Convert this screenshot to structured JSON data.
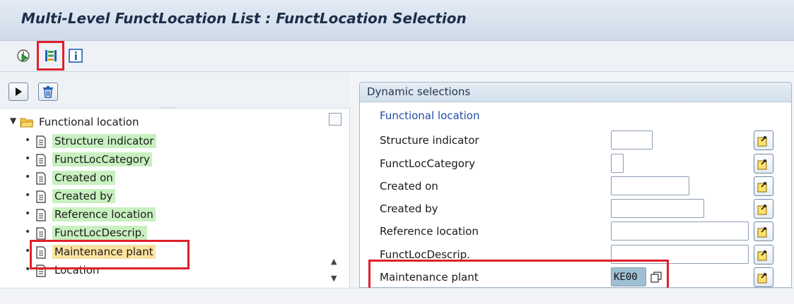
{
  "title": "Multi-Level FunctLocation List : FunctLocation Selection",
  "toolbar": {
    "execute_icon": "execute-clock-icon",
    "dynamic_selections_icon": "dynamic-selections-icon",
    "info_icon": "info-icon"
  },
  "left": {
    "expand_icon": "triangle-right-icon",
    "delete_icon": "trash-icon",
    "tree": {
      "root": "Functional location",
      "items": [
        {
          "label": "Structure indicator",
          "selected": false
        },
        {
          "label": "FunctLocCategory",
          "selected": false
        },
        {
          "label": "Created on",
          "selected": false
        },
        {
          "label": "Created by",
          "selected": false
        },
        {
          "label": "Reference location",
          "selected": false
        },
        {
          "label": "FunctLocDescrip.",
          "selected": false
        },
        {
          "label": "Maintenance plant",
          "selected": true
        },
        {
          "label": "Location",
          "selected": false
        }
      ]
    }
  },
  "right": {
    "header": "Dynamic selections",
    "group": "Functional location",
    "fields": [
      {
        "label": "Structure indicator",
        "value": ""
      },
      {
        "label": "FunctLocCategory",
        "value": ""
      },
      {
        "label": "Created on",
        "value": ""
      },
      {
        "label": "Created by",
        "value": ""
      },
      {
        "label": "Reference location",
        "value": ""
      },
      {
        "label": "FunctLocDescrip.",
        "value": ""
      },
      {
        "label": "Maintenance plant",
        "value": "KE00"
      }
    ]
  },
  "colors": {
    "highlight": "#e0202a",
    "tree_label_bg": "#c8f0c0",
    "tree_selected_bg": "#fde2a0",
    "filled_input_bg": "#9fbfd4",
    "group_label": "#1f4ea8"
  }
}
